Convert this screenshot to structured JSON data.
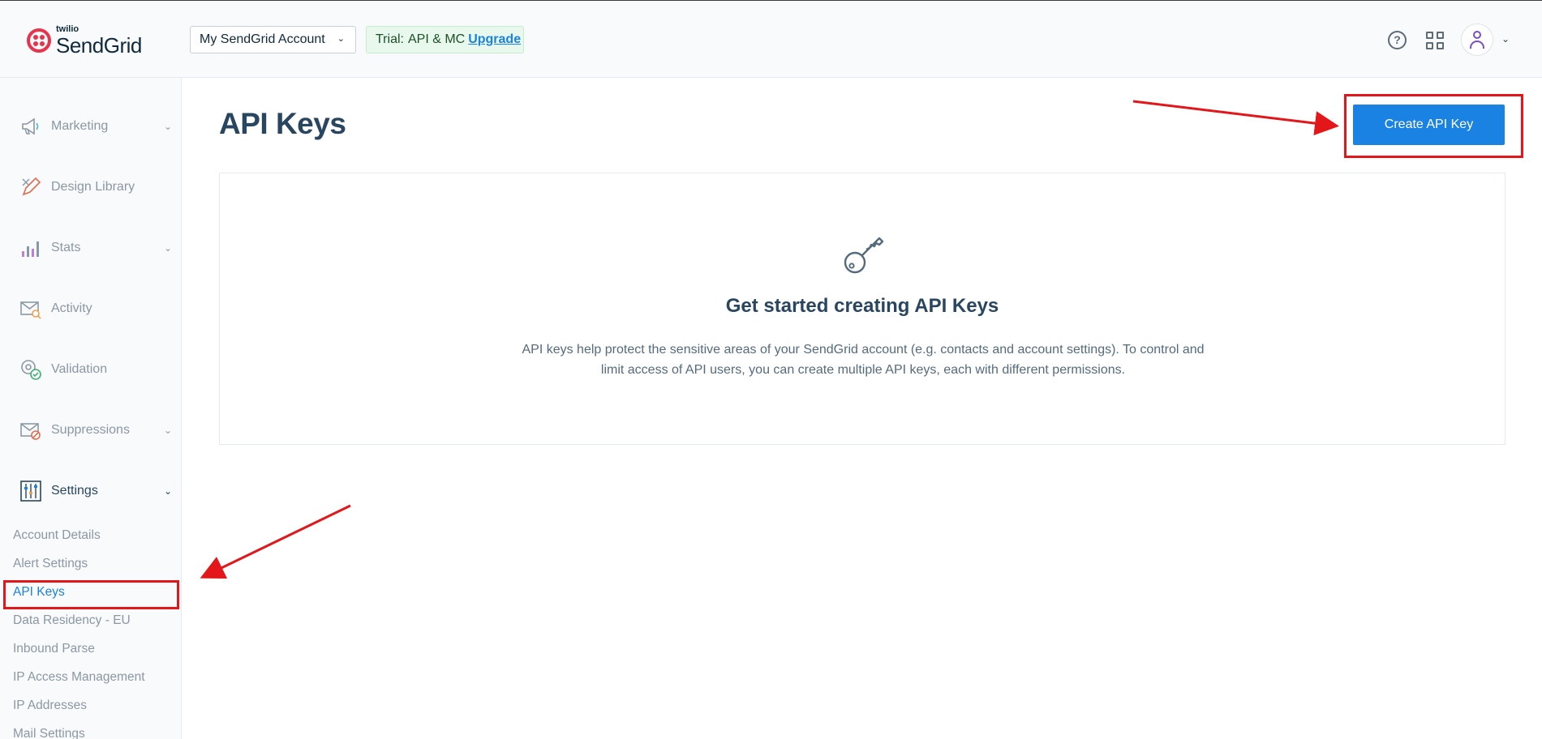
{
  "header": {
    "logo_top": "twilio",
    "logo_main": "SendGrid",
    "account_select": "My SendGrid Account",
    "trial_label": "Trial:",
    "trial_plan": "API & MC",
    "upgrade_link": "Upgrade"
  },
  "sidebar": {
    "items": [
      {
        "label": "Marketing",
        "icon": "megaphone-icon",
        "has_chevron": true
      },
      {
        "label": "Design Library",
        "icon": "design-pencil-icon",
        "has_chevron": false
      },
      {
        "label": "Stats",
        "icon": "bar-chart-icon",
        "has_chevron": true
      },
      {
        "label": "Activity",
        "icon": "envelope-search-icon",
        "has_chevron": false
      },
      {
        "label": "Validation",
        "icon": "at-check-icon",
        "has_chevron": false
      },
      {
        "label": "Suppressions",
        "icon": "envelope-block-icon",
        "has_chevron": true
      },
      {
        "label": "Settings",
        "icon": "sliders-icon",
        "has_chevron": true
      }
    ],
    "settings_sub": [
      "Account Details",
      "Alert Settings",
      "API Keys",
      "Data Residency - EU",
      "Inbound Parse",
      "IP Access Management",
      "IP Addresses",
      "Mail Settings"
    ],
    "active_sub": "API Keys"
  },
  "main": {
    "title": "API Keys",
    "create_button": "Create API Key",
    "empty_title": "Get started creating API Keys",
    "empty_desc_line1": "API keys help protect the sensitive areas of your SendGrid account (e.g. contacts and account settings). To control and",
    "empty_desc_line2": "limit access of API users, you can create multiple API keys, each with different permissions."
  },
  "colors": {
    "accent": "#1a82e2",
    "heading": "#294661",
    "annotation": "#e3161a",
    "brand": "#e8334a"
  }
}
